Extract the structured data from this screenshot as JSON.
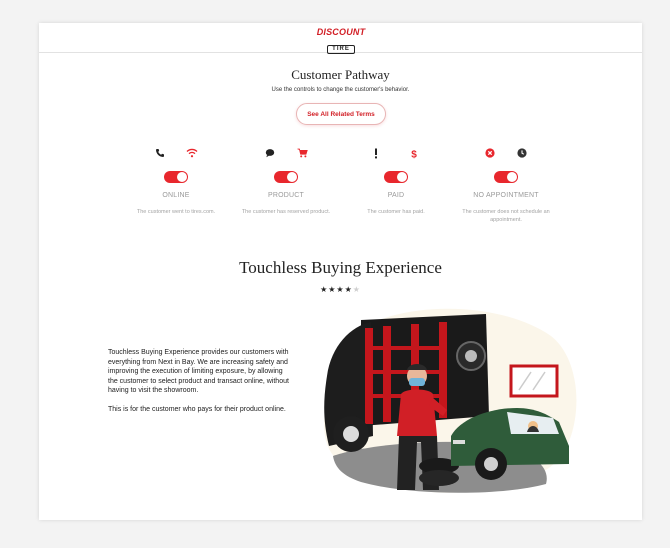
{
  "header": {
    "logo_top": "DISCOUNT",
    "logo_bottom": "TIRE"
  },
  "pathway": {
    "title": "Customer Pathway",
    "subtitle": "Use the controls to change the customer's behavior.",
    "terms_button": "See All Related Terms"
  },
  "controls": [
    {
      "label": "ONLINE",
      "icons": [
        "phone-icon",
        "wifi-icon"
      ],
      "active_icon": "wifi-icon",
      "enabled": true,
      "description": "The customer went to tires.com."
    },
    {
      "label": "PRODUCT",
      "icons": [
        "chat-icon",
        "cart-icon"
      ],
      "active_icon": "cart-icon",
      "enabled": true,
      "description": "The customer has reserved product."
    },
    {
      "label": "PAID",
      "icons": [
        "exclamation-icon",
        "dollar-icon"
      ],
      "active_icon": "dollar-icon",
      "enabled": true,
      "description": "The customer has paid."
    },
    {
      "label": "NO APPOINTMENT",
      "icons": [
        "x-circle-icon",
        "clock-icon"
      ],
      "active_icon": "x-circle-icon",
      "enabled": true,
      "description": "The customer does not schedule an appointment."
    }
  ],
  "experience": {
    "title": "Touchless Buying Experience",
    "rating": 4,
    "rating_max": 5,
    "paragraphs": [
      "Touchless Buying Experience provides our customers with everything from Next in Bay. We are increasing safety and improving the execution of limiting exposure, by allowing the customer to select product and transact online, without having to visit the showroom.",
      "This is for the customer who pays for their product online."
    ]
  },
  "colors": {
    "accent": "#e8272d",
    "brand_red": "#d21f26",
    "muted_text": "#9a9a9a",
    "car_green": "#2f5c3a"
  }
}
